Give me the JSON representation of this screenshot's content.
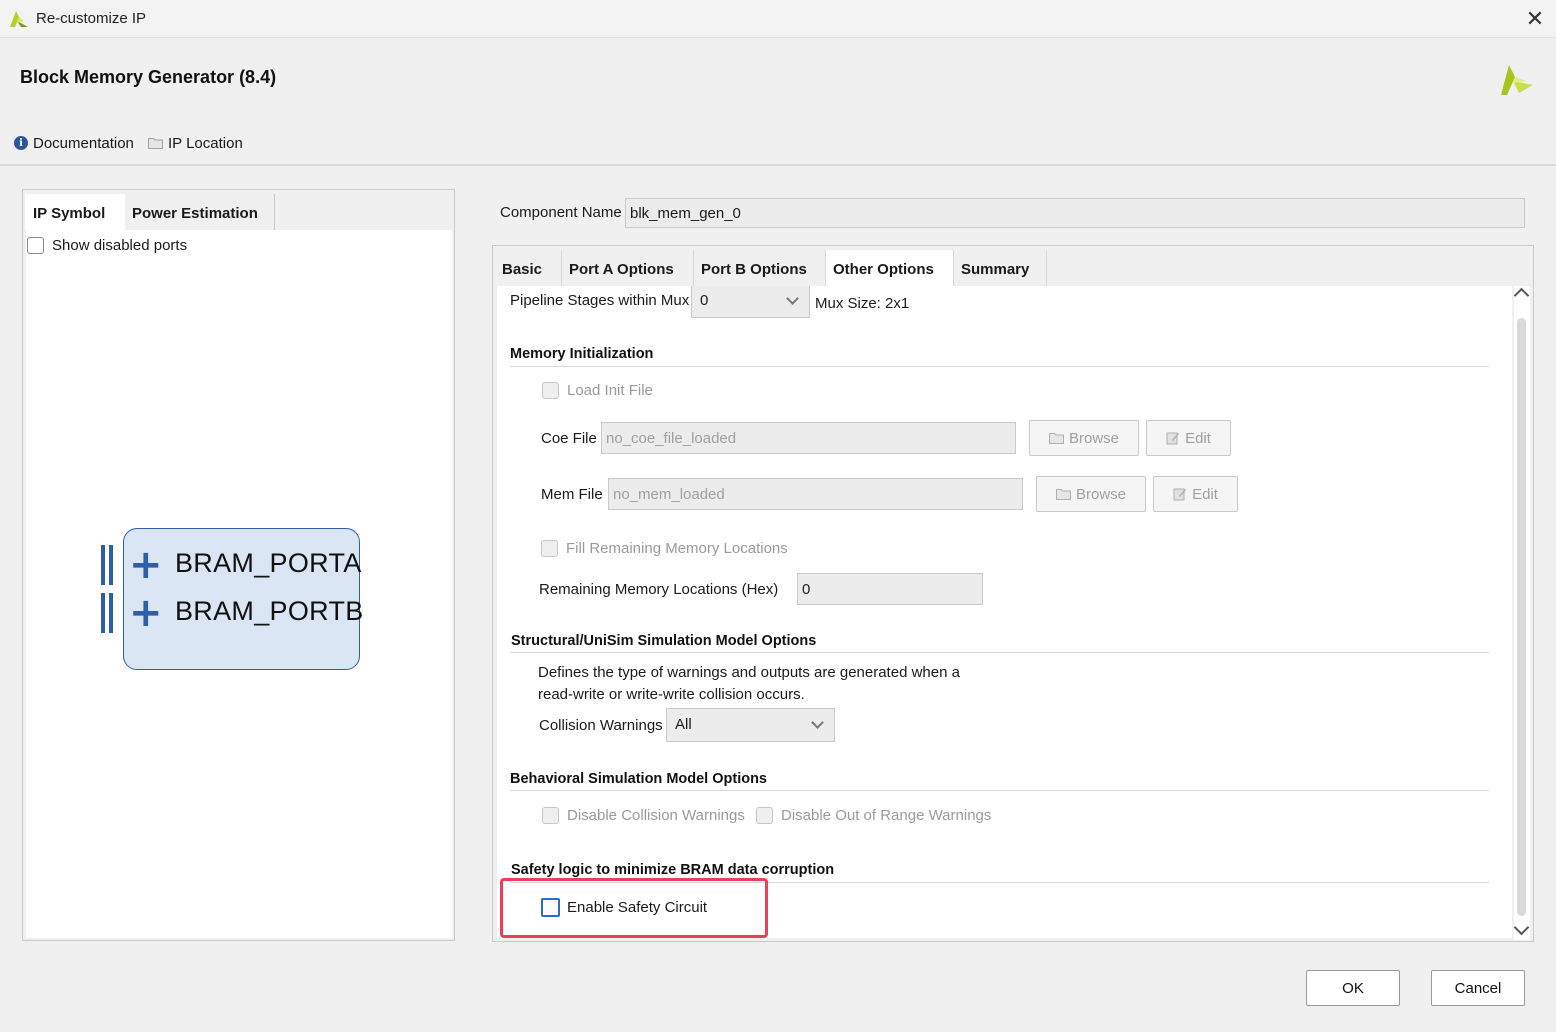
{
  "window": {
    "title": "Re-customize IP",
    "close_symbol": "✕"
  },
  "header": {
    "ip_title": "Block Memory Generator (8.4)",
    "documentation_label": "Documentation",
    "ip_location_label": "IP Location"
  },
  "left_panel": {
    "tabs": [
      {
        "label": "IP Symbol",
        "active": true
      },
      {
        "label": "Power Estimation",
        "active": false
      }
    ],
    "show_disabled_ports_label": "Show disabled ports",
    "show_disabled_ports_checked": false,
    "symbol": {
      "ports": [
        "BRAM_PORTA",
        "BRAM_PORTB"
      ],
      "plus_symbol": "+"
    }
  },
  "component": {
    "label": "Component Name",
    "value": "blk_mem_gen_0"
  },
  "right_tabs": [
    {
      "label": "Basic",
      "active": false
    },
    {
      "label": "Port A Options",
      "active": false
    },
    {
      "label": "Port B Options",
      "active": false
    },
    {
      "label": "Other Options",
      "active": true
    },
    {
      "label": "Summary",
      "active": false
    }
  ],
  "other_options": {
    "pipeline": {
      "label": "Pipeline Stages within Mux",
      "value": "0",
      "mux_size": "Mux Size: 2x1"
    },
    "memory_init": {
      "title": "Memory Initialization",
      "load_init_file_label": "Load Init File",
      "coe_file_label": "Coe File",
      "coe_file_value": "no_coe_file_loaded",
      "mem_file_label": "Mem File",
      "mem_file_value": "no_mem_loaded",
      "browse_label": "Browse",
      "edit_label": "Edit",
      "fill_remaining_label": "Fill Remaining Memory Locations",
      "remaining_label": "Remaining Memory Locations (Hex)",
      "remaining_value": "0"
    },
    "structural": {
      "title": "Structural/UniSim Simulation Model Options",
      "desc_line1": "Defines the type of warnings and outputs are generated when a",
      "desc_line2": "read-write or write-write collision occurs.",
      "collision_label": "Collision Warnings",
      "collision_value": "All"
    },
    "behavioral": {
      "title": "Behavioral Simulation Model Options",
      "disable_collision_label": "Disable Collision Warnings",
      "disable_out_of_range_label": "Disable Out of Range Warnings"
    },
    "safety": {
      "title": "Safety logic to minimize BRAM data corruption",
      "enable_label": "Enable Safety Circuit",
      "enable_checked": false
    }
  },
  "footer": {
    "ok_label": "OK",
    "cancel_label": "Cancel"
  },
  "colors": {
    "accent": "#2f5da6",
    "highlight": "#e8415a",
    "brand": "#a8c41f"
  }
}
